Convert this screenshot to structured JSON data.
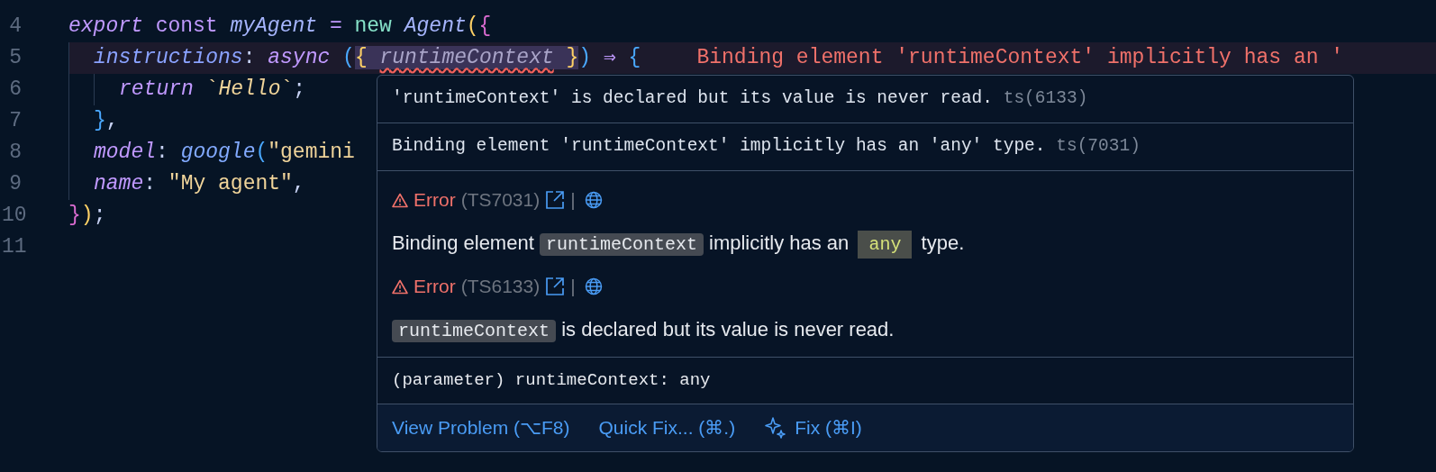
{
  "editor": {
    "lines": [
      {
        "number": "4",
        "highlighted": false,
        "tokens": [
          {
            "text": "export ",
            "kind": "keyword-italic"
          },
          {
            "text": "const ",
            "kind": "keyword"
          },
          {
            "text": "myAgent",
            "kind": "variable"
          },
          {
            "text": " = ",
            "kind": "operator"
          },
          {
            "text": "new ",
            "kind": "new"
          },
          {
            "text": "Agent",
            "kind": "variable"
          },
          {
            "text": "(",
            "kind": "paren-yellow"
          },
          {
            "text": "{",
            "kind": "brace-pink"
          }
        ],
        "children": [
          {
            "number": "5",
            "highlighted": true,
            "tokens": [
              {
                "text": "instructions",
                "kind": "property"
              },
              {
                "text": ": ",
                "kind": "plain"
              },
              {
                "text": "async ",
                "kind": "keyword-italic"
              },
              {
                "text": "(",
                "kind": "brace-blue"
              },
              {
                "text": "{ ",
                "kind": "paren-yellow-match"
              },
              {
                "text": "runtimeContext",
                "kind": "param-error"
              },
              {
                "text": " }",
                "kind": "paren-yellow-match"
              },
              {
                "text": ")",
                "kind": "brace-blue"
              },
              {
                "text": " ⇒ ",
                "kind": "operator"
              },
              {
                "text": "{",
                "kind": "brace-blue"
              }
            ],
            "inline_error": "Binding element 'runtimeContext' implicitly has an '",
            "children": [
              {
                "number": "6",
                "highlighted": false,
                "tokens": [
                  {
                    "text": "return ",
                    "kind": "keyword-italic"
                  },
                  {
                    "text": "`",
                    "kind": "string"
                  },
                  {
                    "text": "Hello",
                    "kind": "string-italic"
                  },
                  {
                    "text": "`",
                    "kind": "string"
                  },
                  {
                    "text": ";",
                    "kind": "plain"
                  }
                ]
              }
            ]
          },
          {
            "number": "7",
            "highlighted": false,
            "tokens": [
              {
                "text": "}",
                "kind": "brace-blue"
              },
              {
                "text": ",",
                "kind": "plain"
              }
            ]
          },
          {
            "number": "8",
            "highlighted": false,
            "tokens": [
              {
                "text": "model",
                "kind": "property-purple"
              },
              {
                "text": ": ",
                "kind": "plain"
              },
              {
                "text": "google",
                "kind": "function"
              },
              {
                "text": "(",
                "kind": "brace-blue"
              },
              {
                "text": "\"gemini",
                "kind": "string"
              }
            ]
          },
          {
            "number": "9",
            "highlighted": false,
            "tokens": [
              {
                "text": "name",
                "kind": "property-purple"
              },
              {
                "text": ": ",
                "kind": "plain"
              },
              {
                "text": "\"My agent\"",
                "kind": "string"
              },
              {
                "text": ",",
                "kind": "plain"
              }
            ]
          }
        ]
      },
      {
        "number": "10",
        "highlighted": false,
        "tokens": [
          {
            "text": "}",
            "kind": "brace-pink"
          },
          {
            "text": ")",
            "kind": "paren-yellow"
          },
          {
            "text": ";",
            "kind": "plain"
          }
        ]
      },
      {
        "number": "11",
        "highlighted": false
      }
    ]
  },
  "hover": {
    "messages": [
      {
        "text": "'runtimeContext' is declared but its value is never read.",
        "code": "ts(6133)"
      },
      {
        "text": "Binding element 'runtimeContext' implicitly has an 'any' type.",
        "code": "ts(7031)"
      }
    ],
    "problems": [
      {
        "severity": "Error",
        "code": "(TS7031)",
        "separator": "|",
        "description": [
          {
            "text": "Binding element ",
            "kind": "text"
          },
          {
            "text": "runtimeContext",
            "kind": "code"
          },
          {
            "text": " implicitly has an ",
            "kind": "text"
          },
          {
            "text": "any",
            "kind": "type"
          },
          {
            "text": " type.",
            "kind": "text"
          }
        ]
      },
      {
        "severity": "Error",
        "code": "(TS6133)",
        "separator": "|",
        "description": [
          {
            "text": "runtimeContext",
            "kind": "code"
          },
          {
            "text": " is declared but its value is never read.",
            "kind": "text"
          }
        ]
      }
    ],
    "signature": "(parameter) runtimeContext: any",
    "actions": [
      {
        "label": "View Problem (⌥F8)",
        "kind": "link"
      },
      {
        "label": "Quick Fix... (⌘.)",
        "kind": "link"
      },
      {
        "label": "Fix (⌘I)",
        "kind": "ai"
      }
    ]
  }
}
